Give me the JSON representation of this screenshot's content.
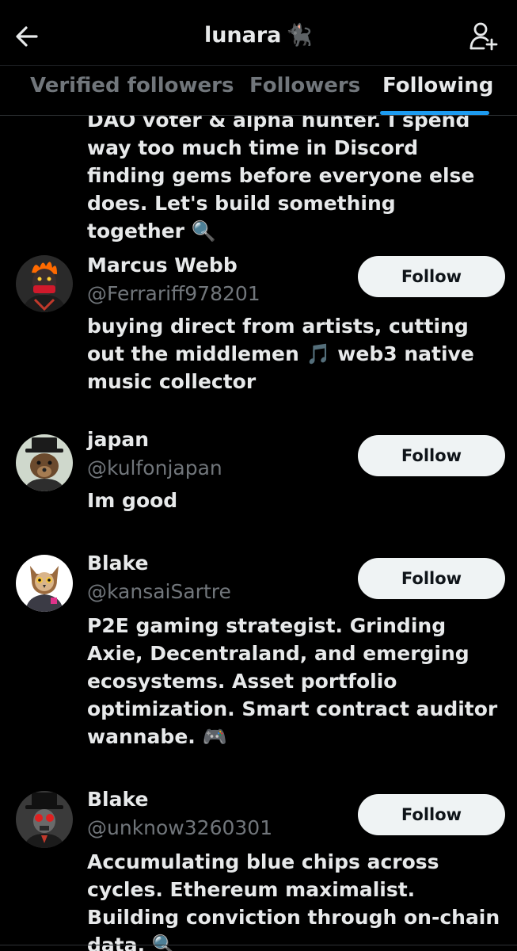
{
  "header": {
    "title": "lunara",
    "title_emoji": "🐈‍⬛",
    "back_icon": "arrow-left-icon",
    "add_user_icon": "person-add-icon"
  },
  "tabs": [
    {
      "label": "Verified followers",
      "active": false
    },
    {
      "label": "Followers",
      "active": false
    },
    {
      "label": "Following",
      "active": true
    }
  ],
  "partial_bio": "DAO voter & alpha hunter. I spend way too much time in Discord finding gems before everyone else does. Let's build something together 🔍",
  "users": [
    {
      "name": "Marcus Webb",
      "handle": "@Ferrariff978201",
      "bio": "buying direct from artists, cutting out the middlemen 🎵 web3 native music collector",
      "follow_label": "Follow"
    },
    {
      "name": "japan",
      "handle": "@kulfonjapan",
      "bio": "Im good",
      "follow_label": "Follow"
    },
    {
      "name": "Blake",
      "handle": "@kansaiSartre",
      "bio": "P2E gaming strategist. Grinding Axie, Decentraland, and emerging ecosystems. Asset portfolio optimization. Smart contract auditor wannabe. 🎮",
      "follow_label": "Follow"
    },
    {
      "name": "Blake",
      "handle": "@unknow3260301",
      "bio": "Accumulating blue chips across cycles. Ethereum maximalist. Building conviction through on-chain data. 🔍",
      "follow_label": "Follow"
    }
  ],
  "colors": {
    "background": "#000000",
    "text": "#e7e9ea",
    "muted": "#71767b",
    "accent": "#1d9bf0",
    "follow_button": "#eff3f4"
  }
}
